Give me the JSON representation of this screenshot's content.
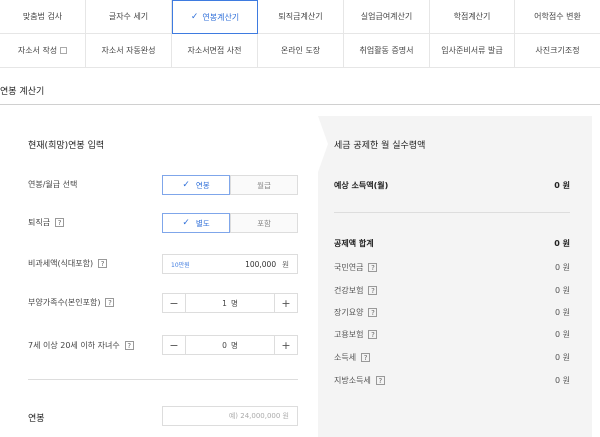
{
  "tabs_row1": [
    {
      "label": "맞춤법 검사",
      "active": false
    },
    {
      "label": "글자수 세기",
      "active": false
    },
    {
      "label": "연봉계산기",
      "active": true
    },
    {
      "label": "퇴직금계산기",
      "active": false
    },
    {
      "label": "실업급여계산기",
      "active": false
    },
    {
      "label": "학점계산기",
      "active": false
    },
    {
      "label": "어학점수 변환",
      "active": false
    }
  ],
  "tabs_row2": [
    {
      "label": "자소서 작성"
    },
    {
      "label": "자소서 자동완성"
    },
    {
      "label": "자소서면접 사전"
    },
    {
      "label": "온라인 도장"
    },
    {
      "label": "취업활동 증명서"
    },
    {
      "label": "입사준비서류 발급"
    },
    {
      "label": "사진크기조정"
    }
  ],
  "section_title": "연봉 계산기",
  "left": {
    "heading": "현재(희망)연봉 입력",
    "salary_type": {
      "label": "연봉/월급 선택",
      "options": [
        "연봉",
        "월급"
      ],
      "selected": "연봉"
    },
    "severance": {
      "label": "퇴직금",
      "help": "?",
      "options": [
        "별도",
        "포함"
      ],
      "selected": "별도"
    },
    "nontax": {
      "label": "비과세액(식대포함)",
      "help": "?",
      "tag": "10만원",
      "value": "100,000",
      "unit": "원"
    },
    "dependents": {
      "label": "부양가족수(본인포함)",
      "help": "?",
      "value": "1",
      "unit": "명",
      "minus": "−",
      "plus": "+"
    },
    "children": {
      "label": "7세 이상 20세 이하 자녀수",
      "help": "?",
      "value": "0",
      "unit": "명",
      "minus": "−",
      "plus": "+"
    },
    "annual": {
      "label": "연봉",
      "placeholder": "예) 24,000,000 원"
    }
  },
  "right": {
    "heading": "세금 공제한 월 실수령액",
    "expected": {
      "label": "예상 소득액(월)",
      "value": "0 원"
    },
    "total": {
      "label": "공제액 합계",
      "value": "0 원"
    },
    "items": [
      {
        "label": "국민연금",
        "value": "0 원"
      },
      {
        "label": "건강보험",
        "value": "0 원"
      },
      {
        "label": "장기요양",
        "value": "0 원"
      },
      {
        "label": "고용보험",
        "value": "0 원"
      },
      {
        "label": "소득세",
        "value": "0 원"
      },
      {
        "label": "지방소득세",
        "value": "0 원"
      }
    ],
    "help": "?"
  },
  "colors": {
    "accent": "#2f6fd9",
    "panel_bg": "#f4f4f4",
    "border": "#dddddd"
  }
}
